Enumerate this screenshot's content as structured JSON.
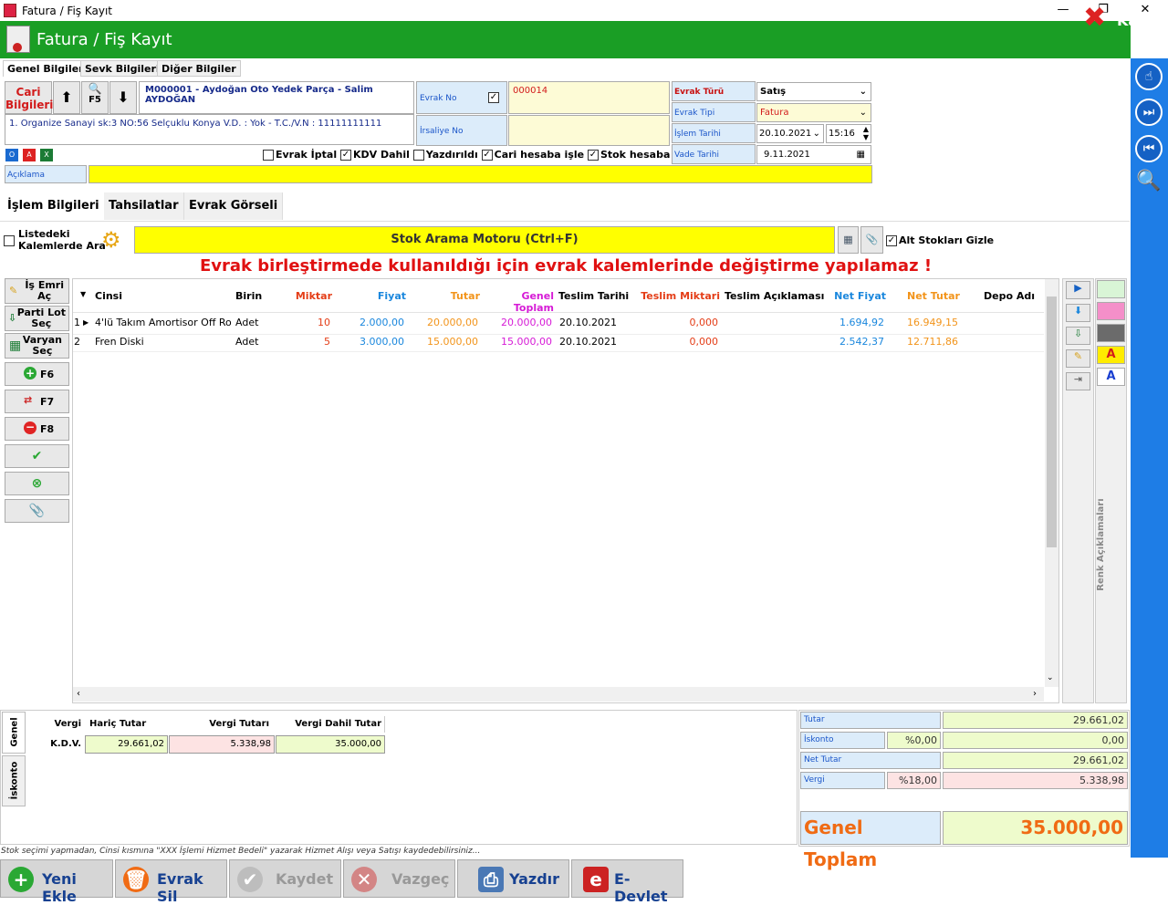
{
  "window": {
    "title": "Fatura / Fiş Kayıt",
    "minimize": "—",
    "restore": "❐",
    "close": "✕"
  },
  "header": {
    "title": "Fatura / Fiş Kayıt",
    "close_label": "Kapat"
  },
  "tabs": [
    "Genel Bilgiler",
    "Sevk Bilgileri",
    "Diğer Bilgiler"
  ],
  "cari": {
    "button": "Cari\nBilgileri",
    "f5": "F5",
    "name": "M000001 - Aydoğan Oto Yedek Parça - Salim AYDOĞAN",
    "address": "1. Organize Sanayi sk:3 NO:56 Selçuklu Konya V.D. :  Yok - T.C./V.N :  11111111111"
  },
  "evrak": {
    "no_label": "Evrak No",
    "no_value": "000014",
    "irsaliye_label": "İrsaliye No",
    "irsaliye_value": ""
  },
  "right_fields": {
    "turu_label": "Evrak Türü",
    "turu_value": "Satış",
    "tipi_label": "Evrak Tipi",
    "tipi_value": "Fatura",
    "islem_label": "İşlem Tarihi",
    "islem_date": "20.10.2021",
    "islem_time": "15:16",
    "vade_label": "Vade Tarihi",
    "vade_value": "9.11.2021"
  },
  "checks": {
    "iptal": "Evrak İptal",
    "kdv": "KDV Dahil",
    "yazdirildi": "Yazdırıldı",
    "cari": "Cari hesaba işle",
    "stok": "Stok hesaba işle"
  },
  "aciklama_label": "Açıklama",
  "subtabs": [
    "İşlem Bilgileri",
    "Tahsilatlar",
    "Evrak Görseli"
  ],
  "search": {
    "listedeki": "Listedeki\nKalemlerde Ara",
    "motor": "Stok Arama Motoru (Ctrl+F)",
    "alt": "Alt Stokları Gizle"
  },
  "warning": "Evrak birleştirmede kullanıldığı için evrak kalemlerinde değiştirme yapılamaz !",
  "left_buttons": {
    "is_emri": "İş Emri\nAç",
    "parti": "Parti Lot\nSeç",
    "varyant": "Varyan\nSeç",
    "f6": "F6",
    "f7": "F7",
    "f8": "F8"
  },
  "columns": [
    "Cinsi",
    "Birin",
    "Miktar",
    "Fiyat",
    "Tutar",
    "Genel Toplam",
    "Teslim Tarihi",
    "Teslim Miktari",
    "Teslim Açıklaması",
    "Net Fiyat",
    "Net Tutar",
    "Depo Adı"
  ],
  "rows": [
    {
      "no": "1",
      "cinsi": "4'lü Takım Amortisor Off Ro",
      "birim": "Adet",
      "miktar": "10",
      "fiyat": "2.000,00",
      "tutar": "20.000,00",
      "genel": "20.000,00",
      "teslim_tarihi": "20.10.2021",
      "teslim_miktari": "0,000",
      "teslim_aciklama": "",
      "net_fiyat": "1.694,92",
      "net_tutar": "16.949,15",
      "depo": ""
    },
    {
      "no": "2",
      "cinsi": "Fren Diski",
      "birim": "Adet",
      "miktar": "5",
      "fiyat": "3.000,00",
      "tutar": "15.000,00",
      "genel": "15.000,00",
      "teslim_tarihi": "20.10.2021",
      "teslim_miktari": "0,000",
      "teslim_aciklama": "",
      "net_fiyat": "2.542,37",
      "net_tutar": "12.711,86",
      "depo": ""
    }
  ],
  "renk_aciklamalari": "Renk Açıklamaları",
  "color_swatches": [
    "#d9f5d6",
    "#f48fc9",
    "#6b6b6b"
  ],
  "vtabs": [
    "Genel",
    "İskonto"
  ],
  "vergi_table": {
    "headers": [
      "Vergi",
      "Hariç Tutar",
      "Vergi Tutarı",
      "Vergi Dahil Tutar"
    ],
    "row": {
      "vergi": "K.D.V.",
      "haric": "29.661,02",
      "tutar": "5.338,98",
      "dahil": "35.000,00"
    }
  },
  "summary": {
    "tutar_label": "Tutar",
    "tutar": "29.661,02",
    "iskonto_label": "İskonto",
    "iskonto_pct": "%0,00",
    "iskonto": "0,00",
    "net_label": "Net Tutar",
    "net": "29.661,02",
    "vergi_label": "Vergi",
    "vergi_pct": "%18,00",
    "vergi": "5.338,98",
    "genel_label": "Genel Toplam",
    "genel": "35.000,00"
  },
  "status": "Stok seçimi yapmadan, Cinsi kısmına \"XXX İşlemi Hizmet Bedeli\" yazarak Hizmet Alışı veya Satışı kaydedebilirsiniz...",
  "bottom_buttons": [
    "Yeni Ekle",
    "Evrak Sil",
    "Kaydet",
    "Vazgeç",
    "Yazdır",
    "E-Devlet"
  ]
}
